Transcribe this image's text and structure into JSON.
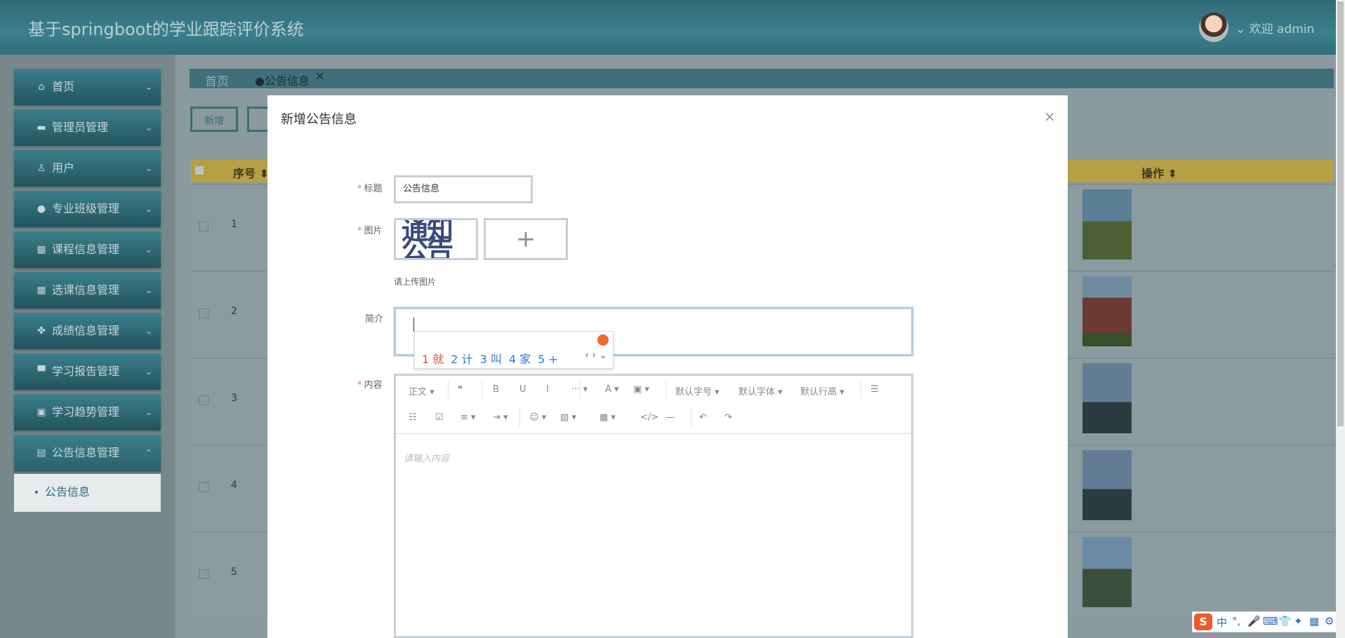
{
  "app": {
    "title": "基于springboot的学业跟踪评价系统",
    "welcome": "欢迎 admin"
  },
  "sidebar": {
    "items": [
      {
        "label": "首页",
        "icon": "home-icon",
        "glyph": "⌂"
      },
      {
        "label": "管理员管理",
        "icon": "admin-icon",
        "glyph": "▬"
      },
      {
        "label": "用户",
        "icon": "user-icon",
        "glyph": "♙"
      },
      {
        "label": "专业班级管理",
        "icon": "class-icon",
        "glyph": "●"
      },
      {
        "label": "课程信息管理",
        "icon": "course-icon",
        "glyph": "▦"
      },
      {
        "label": "选课信息管理",
        "icon": "selection-icon",
        "glyph": "▦"
      },
      {
        "label": "成绩信息管理",
        "icon": "score-icon",
        "glyph": "✤"
      },
      {
        "label": "学习报告管理",
        "icon": "report-icon",
        "glyph": "▀"
      },
      {
        "label": "学习趋势管理",
        "icon": "trend-icon",
        "glyph": "▣"
      },
      {
        "label": "公告信息管理",
        "icon": "notice-icon",
        "glyph": "▤"
      }
    ],
    "submenu": {
      "label": "公告信息"
    }
  },
  "breadcrumb": {
    "home": "首页",
    "current": "公告信息",
    "close": "×"
  },
  "actions": {
    "add": "新增"
  },
  "table": {
    "headers": {
      "seq": "序号",
      "op": "操作"
    },
    "rows": [
      "1",
      "2",
      "3",
      "4",
      "5"
    ]
  },
  "modal": {
    "title": "新增公告信息",
    "close": "×",
    "fields": {
      "title_label": "标题",
      "title_value": "公告信息",
      "image_label": "图片",
      "image_text": "通知公告",
      "upload_plus": "+",
      "upload_tip": "请上传图片",
      "intro_label": "简介",
      "content_label": "内容",
      "required_mark": "*"
    },
    "editor": {
      "toolbar_row1": [
        {
          "label": "正文 ▾",
          "name": "paragraph-select"
        },
        {
          "label": "❝",
          "name": "quote-icon"
        },
        {
          "label": "B",
          "name": "bold-icon"
        },
        {
          "label": "U",
          "name": "underline-icon"
        },
        {
          "label": "I",
          "name": "italic-icon"
        },
        {
          "label": "··· ▾",
          "name": "more-icon"
        },
        {
          "label": "A ▾",
          "name": "font-color-icon"
        },
        {
          "label": "▣ ▾",
          "name": "bg-color-icon"
        },
        {
          "label": "默认字号 ▾",
          "name": "font-size-select"
        },
        {
          "label": "默认字体 ▾",
          "name": "font-family-select"
        },
        {
          "label": "默认行高 ▾",
          "name": "line-height-select"
        },
        {
          "label": "☰",
          "name": "bullet-list-icon"
        }
      ],
      "toolbar_row2": [
        {
          "label": "☷",
          "name": "ordered-list-icon"
        },
        {
          "label": "☑",
          "name": "todo-icon"
        },
        {
          "label": "≡ ▾",
          "name": "align-icon"
        },
        {
          "label": "⇥ ▾",
          "name": "indent-icon"
        },
        {
          "label": "☺ ▾",
          "name": "emoji-icon"
        },
        {
          "label": "▨ ▾",
          "name": "image-icon"
        },
        {
          "label": "▦ ▾",
          "name": "table-icon"
        },
        {
          "label": "</>",
          "name": "code-icon"
        },
        {
          "label": "—",
          "name": "divider-icon"
        },
        {
          "label": "↶",
          "name": "undo-icon"
        },
        {
          "label": "↷",
          "name": "redo-icon"
        }
      ],
      "placeholder": "请输入内容"
    }
  },
  "ime": {
    "candidates": [
      "1 就",
      "2 计",
      "3 叫",
      "4 家",
      "5 +"
    ],
    "nav": "‹ › ⌄",
    "statusbar": [
      "中",
      "°,",
      "🎤",
      "⌨",
      "👕",
      "✦",
      "▦",
      "⚙"
    ]
  },
  "colors": {
    "accent": "#2e6a78",
    "header": "#3b7f8d",
    "required": "#f56c6c",
    "table_head": "#b7a044"
  }
}
